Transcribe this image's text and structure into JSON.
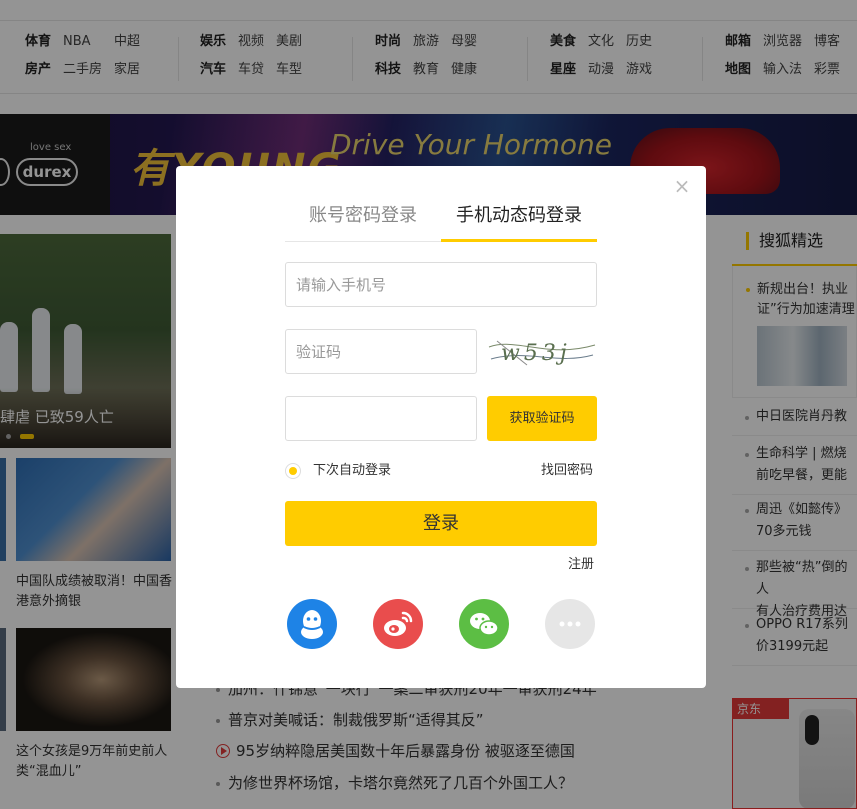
{
  "nav": {
    "groups": [
      {
        "items": [
          "体育",
          "NBA",
          "中超",
          "房产",
          "二手房",
          "家居"
        ]
      },
      {
        "items": [
          "娱乐",
          "视频",
          "美剧",
          "汽车",
          "车贷",
          "车型"
        ]
      },
      {
        "items": [
          "时尚",
          "旅游",
          "母婴",
          "科技",
          "教育",
          "健康"
        ]
      },
      {
        "items": [
          "美食",
          "文化",
          "历史",
          "星座",
          "动漫",
          "游戏"
        ]
      },
      {
        "items": [
          "邮箱",
          "浏览器",
          "博客",
          "地图",
          "输入法",
          "彩票"
        ]
      }
    ]
  },
  "banner": {
    "brand_top": "love sex",
    "brand_logo": "durex",
    "slogan": "有YOUNG",
    "slogan2": "Drive Your Hormone"
  },
  "left": {
    "headline_caption": "肆虐 已致59人亡",
    "tile1_caption": "中国队成绩被取消！中国香港意外摘银",
    "tile2_caption": "这个女孩是9万年前史前人类“混血儿”"
  },
  "news": [
    {
      "text": "加州：什锦意“一块行”一案二审获刑20年一审获刑24年",
      "video": false
    },
    {
      "text": "普京对美喊话：制裁俄罗斯“适得其反”",
      "video": false
    },
    {
      "text": "95岁纳粹隐居美国数十年后暴露身份 被驱逐至德国",
      "video": true
    },
    {
      "text": "为修世界杯场馆，卡塔尔竟然死了几百个外国工人？",
      "video": false
    }
  ],
  "sidebar": {
    "title": "搜狐精选",
    "featured_line1": "新规出台！执业",
    "featured_line2": "证”行为加速清理",
    "items": [
      {
        "line1": "中日医院肖丹教",
        "line2": ""
      },
      {
        "line1": "生命科学 | 燃烧",
        "line2": "前吃早餐，更能"
      },
      {
        "line1": "周迅《如懿传》",
        "line2": "70多元钱"
      },
      {
        "line1": "那些被“热”倒的人",
        "line2": "有人治疗费用达"
      },
      {
        "line1": "OPPO R17系列",
        "line2": "价3199元起"
      }
    ],
    "ad_tag": "京东"
  },
  "modal": {
    "close_glyph": "×",
    "tabs": [
      {
        "label": "账号密码登录",
        "active": false
      },
      {
        "label": "手机动态码登录",
        "active": true
      }
    ],
    "phone_placeholder": "请输入手机号",
    "code_placeholder": "验证码",
    "sms_placeholder": "",
    "captcha_text": "w53j",
    "get_code_label": "获取验证码",
    "remember_label": "下次自动登录",
    "remember_checked": true,
    "forgot_label": "找回密码",
    "login_label": "登录",
    "register_label": "注册",
    "social": [
      {
        "name": "qq",
        "icon": "qq-icon",
        "color": "#1e83e6"
      },
      {
        "name": "weibo",
        "icon": "weibo-icon",
        "color": "#e94d4d"
      },
      {
        "name": "wechat",
        "icon": "wechat-icon",
        "color": "#5cbe44"
      },
      {
        "name": "more",
        "icon": "more-icon",
        "color": "#e6e6e6"
      }
    ]
  },
  "colors": {
    "accent": "#ffcc00",
    "overlay": "rgba(0,0,0,0.42)"
  }
}
